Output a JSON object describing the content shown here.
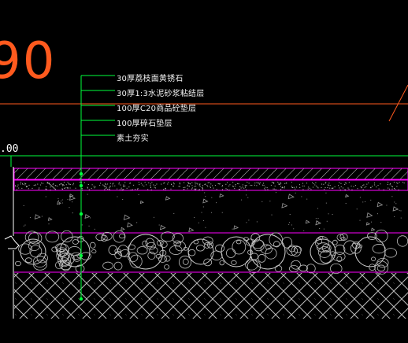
{
  "drawing": {
    "big_number": "90",
    "elevation_text": ".00",
    "layers": [
      {
        "label": "30厚荔枝面黄锈石"
      },
      {
        "label": "30厚1:3水泥砂浆粘结层"
      },
      {
        "label": "100厚C20商品砼垫层"
      },
      {
        "label": "100厚碎石垫层"
      },
      {
        "label": "素土夯实"
      }
    ]
  },
  "colors": {
    "background": "#000000",
    "leader": "#00ff3c",
    "layer_border": "#ff00ff",
    "hatch": "#c8c8c8",
    "orange": "#ff5a1e",
    "text": "#f2f2f2"
  }
}
